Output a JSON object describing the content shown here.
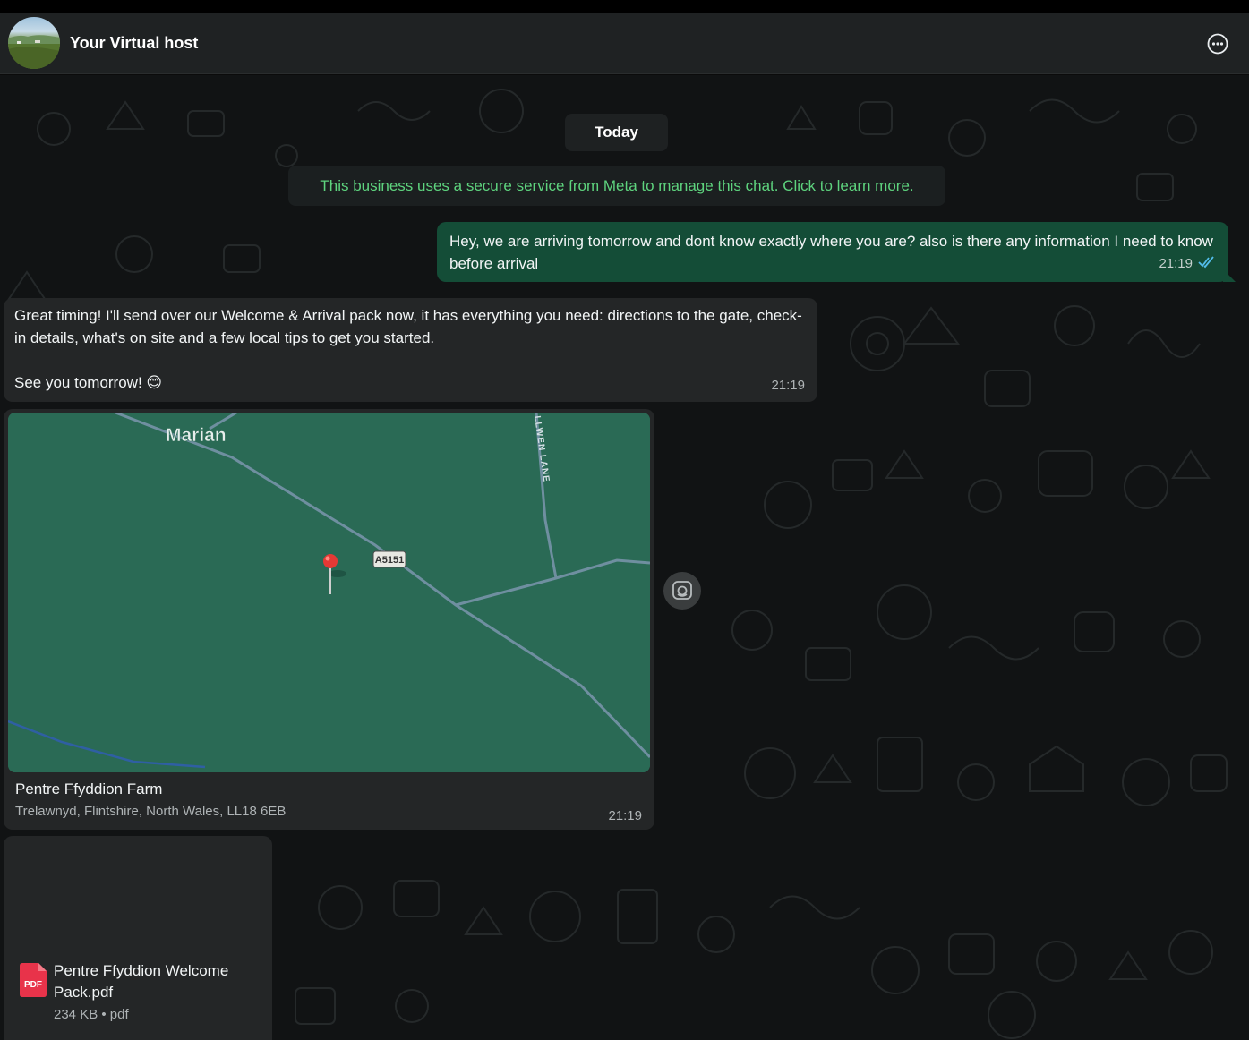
{
  "header": {
    "title": "Your Virtual host",
    "menu_icon": "more-options-icon"
  },
  "chat": {
    "date_chip": "Today",
    "system_note": "This business uses a secure service from Meta to manage this chat. Click to learn more.",
    "outgoing": {
      "text": "Hey, we are arriving tomorrow and dont know exactly where you are? also is there any information I need to know before arrival",
      "time": "21:19",
      "status_icon": "double-check-icon"
    },
    "incoming": {
      "paragraph1": "Great timing! I'll send over our Welcome & Arrival pack now, it has everything you need: directions to the gate, check-in details, what's on site and a few local tips to get you started.",
      "paragraph2": "See you tomorrow! 😊",
      "time": "21:19"
    },
    "location": {
      "map_labels": {
        "town": "Marian",
        "road_badge": "A5151",
        "lane": "LLWEN LANE"
      },
      "name": "Pentre Ffyddion Farm",
      "address": "Trelawnyd, Flintshire, North Wales, LL18 6EB",
      "time": "21:19"
    },
    "document": {
      "icon_text": "PDF",
      "name": "Pentre Ffyddion Welcome Pack.pdf",
      "meta": "234 KB • pdf"
    }
  },
  "colors": {
    "outgoing_bubble": "#144d37",
    "incoming_bubble": "#242627",
    "system_text": "#5ed37e",
    "map_bg": "#2a6a55",
    "pin": "#e53935"
  }
}
